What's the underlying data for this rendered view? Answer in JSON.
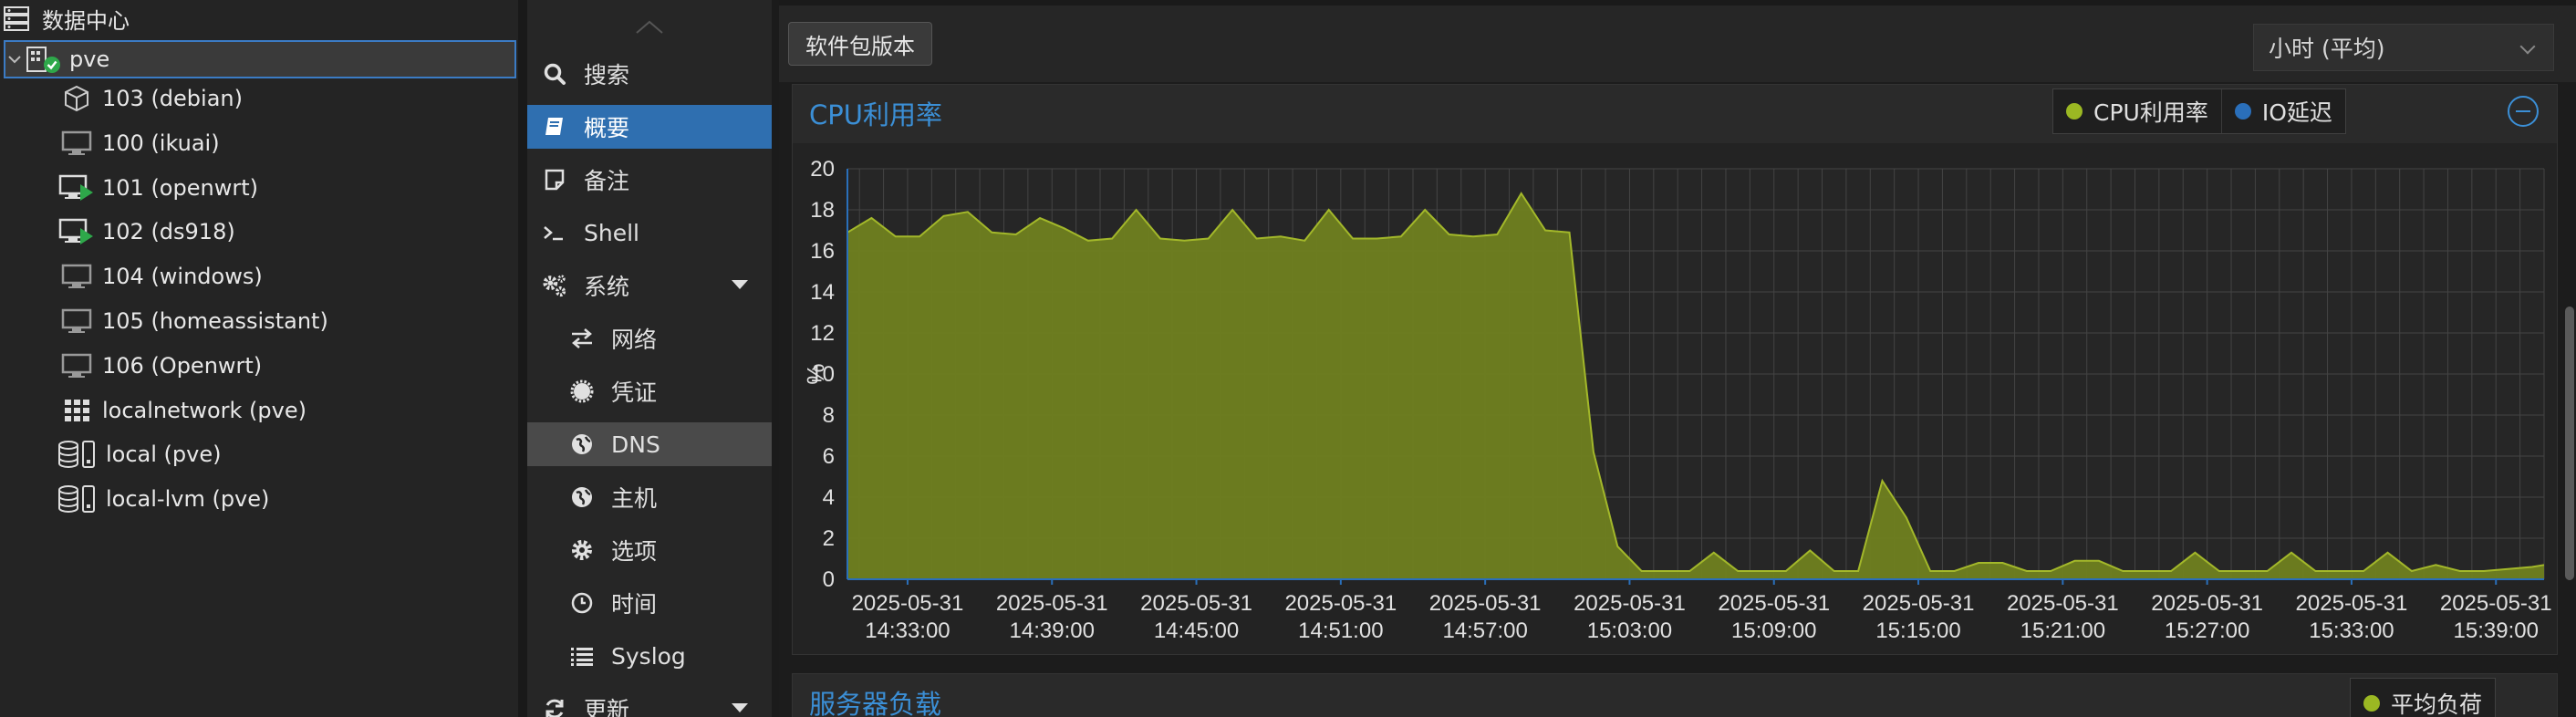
{
  "tree": {
    "datacenter": "数据中心",
    "node": "pve",
    "guests": [
      {
        "label": "103 (debian)",
        "icon": "container-icon"
      },
      {
        "label": "100 (ikuai)",
        "icon": "vm-icon"
      },
      {
        "label": "101 (openwrt)",
        "icon": "vm-running-icon"
      },
      {
        "label": "102 (ds918)",
        "icon": "vm-running-icon"
      },
      {
        "label": "104 (windows)",
        "icon": "vm-icon"
      },
      {
        "label": "105 (homeassistant)",
        "icon": "vm-icon"
      },
      {
        "label": "106 (Openwrt)",
        "icon": "vm-icon"
      },
      {
        "label": "localnetwork (pve)",
        "icon": "network-grid-icon"
      },
      {
        "label": "local (pve)",
        "icon": "storage-icon"
      },
      {
        "label": "local-lvm (pve)",
        "icon": "storage-icon"
      }
    ]
  },
  "menu": {
    "items": [
      {
        "label": "搜索",
        "icon": "search-icon"
      },
      {
        "label": "概要",
        "icon": "book-icon"
      },
      {
        "label": "备注",
        "icon": "note-icon"
      },
      {
        "label": "Shell",
        "icon": "terminal-icon"
      },
      {
        "label": "系统",
        "icon": "gears-icon"
      },
      {
        "label": "网络",
        "icon": "exchange-icon"
      },
      {
        "label": "凭证",
        "icon": "certificate-icon"
      },
      {
        "label": "DNS",
        "icon": "globe-icon"
      },
      {
        "label": "主机",
        "icon": "globe-icon"
      },
      {
        "label": "选项",
        "icon": "gear-icon"
      },
      {
        "label": "时间",
        "icon": "clock-icon"
      },
      {
        "label": "Syslog",
        "icon": "list-icon"
      },
      {
        "label": "更新",
        "icon": "refresh-icon"
      }
    ]
  },
  "toolbar": {
    "package_versions": "软件包版本",
    "timeframe": "小时 (平均)"
  },
  "cpu_panel": {
    "title": "CPU利用率",
    "legend": [
      {
        "label": "CPU利用率",
        "color": "#9bb823"
      },
      {
        "label": "IO延迟",
        "color": "#2a6fba"
      }
    ]
  },
  "load_panel": {
    "title": "服务器负载",
    "legend": [
      {
        "label": "平均负荷",
        "color": "#9bb823"
      }
    ]
  },
  "colors": {
    "accent": "#2f6fb0",
    "title_blue": "#3b8fd6",
    "cpu_fill": "#6f7f1f",
    "cpu_line": "#a3b82a"
  },
  "chart_data": {
    "type": "area",
    "ylabel": "%",
    "ylim": [
      0,
      20
    ],
    "yticks": [
      0,
      2,
      4,
      6,
      8,
      10,
      12,
      14,
      16,
      18,
      20
    ],
    "xlim": [
      "2025-05-31 14:30:30",
      "2025-05-31 15:41:00"
    ],
    "xticks": [
      "2025-05-31 14:33:00",
      "2025-05-31 14:39:00",
      "2025-05-31 14:45:00",
      "2025-05-31 14:51:00",
      "2025-05-31 14:57:00",
      "2025-05-31 15:03:00",
      "2025-05-31 15:09:00",
      "2025-05-31 15:15:00",
      "2025-05-31 15:21:00",
      "2025-05-31 15:27:00",
      "2025-05-31 15:33:00",
      "2025-05-31 15:39:00"
    ],
    "grid": true,
    "series": [
      {
        "name": "CPU利用率",
        "x": [
          "2025-05-31 14:30:30",
          "2025-05-31 14:31:30",
          "2025-05-31 14:32:30",
          "2025-05-31 14:33:30",
          "2025-05-31 14:34:30",
          "2025-05-31 14:35:30",
          "2025-05-31 14:36:30",
          "2025-05-31 14:37:30",
          "2025-05-31 14:38:30",
          "2025-05-31 14:39:30",
          "2025-05-31 14:40:30",
          "2025-05-31 14:41:30",
          "2025-05-31 14:42:30",
          "2025-05-31 14:43:30",
          "2025-05-31 14:44:30",
          "2025-05-31 14:45:30",
          "2025-05-31 14:46:30",
          "2025-05-31 14:47:30",
          "2025-05-31 14:48:30",
          "2025-05-31 14:49:30",
          "2025-05-31 14:50:30",
          "2025-05-31 14:51:30",
          "2025-05-31 14:52:30",
          "2025-05-31 14:53:30",
          "2025-05-31 14:54:30",
          "2025-05-31 14:55:30",
          "2025-05-31 14:56:30",
          "2025-05-31 14:57:30",
          "2025-05-31 14:58:30",
          "2025-05-31 14:59:30",
          "2025-05-31 15:00:30",
          "2025-05-31 15:01:30",
          "2025-05-31 15:02:30",
          "2025-05-31 15:03:30",
          "2025-05-31 15:04:30",
          "2025-05-31 15:05:30",
          "2025-05-31 15:06:30",
          "2025-05-31 15:07:30",
          "2025-05-31 15:08:30",
          "2025-05-31 15:09:30",
          "2025-05-31 15:10:30",
          "2025-05-31 15:11:30",
          "2025-05-31 15:12:30",
          "2025-05-31 15:13:30",
          "2025-05-31 15:14:30",
          "2025-05-31 15:15:30",
          "2025-05-31 15:16:30",
          "2025-05-31 15:17:30",
          "2025-05-31 15:18:30",
          "2025-05-31 15:19:30",
          "2025-05-31 15:20:30",
          "2025-05-31 15:21:30",
          "2025-05-31 15:22:30",
          "2025-05-31 15:23:30",
          "2025-05-31 15:24:30",
          "2025-05-31 15:25:30",
          "2025-05-31 15:26:30",
          "2025-05-31 15:27:30",
          "2025-05-31 15:28:30",
          "2025-05-31 15:29:30",
          "2025-05-31 15:30:30",
          "2025-05-31 15:31:30",
          "2025-05-31 15:32:30",
          "2025-05-31 15:33:30",
          "2025-05-31 15:34:30",
          "2025-05-31 15:35:30",
          "2025-05-31 15:36:30",
          "2025-05-31 15:37:30",
          "2025-05-31 15:38:30",
          "2025-05-31 15:39:30",
          "2025-05-31 15:40:30",
          "2025-05-31 15:41:00"
        ],
        "values": [
          16.9,
          17.6,
          16.7,
          16.7,
          17.7,
          17.9,
          16.9,
          16.8,
          17.6,
          17.1,
          16.5,
          16.6,
          18.0,
          16.6,
          16.5,
          16.6,
          18.0,
          16.6,
          16.7,
          16.5,
          18.0,
          16.6,
          16.6,
          16.7,
          18.0,
          16.8,
          16.7,
          16.8,
          18.8,
          17.0,
          16.9,
          6.2,
          1.6,
          0.4,
          0.4,
          0.4,
          1.3,
          0.4,
          0.4,
          0.4,
          1.4,
          0.4,
          0.4,
          4.8,
          3.0,
          0.4,
          0.4,
          0.8,
          0.8,
          0.4,
          0.4,
          0.9,
          0.9,
          0.4,
          0.4,
          0.4,
          1.3,
          0.4,
          0.4,
          0.4,
          1.3,
          0.4,
          0.4,
          0.4,
          1.3,
          0.4,
          0.7,
          0.4,
          0.4,
          0.5,
          0.6,
          0.7
        ]
      },
      {
        "name": "IO延迟",
        "x": [
          "2025-05-31 14:30:30",
          "2025-05-31 15:41:00"
        ],
        "values": [
          0,
          0
        ]
      }
    ]
  }
}
